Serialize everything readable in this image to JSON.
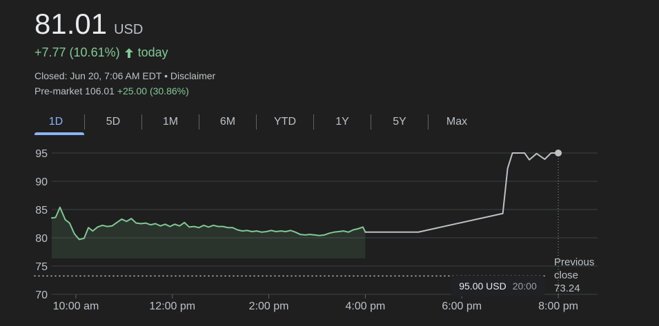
{
  "quote": {
    "price": "81.01",
    "currency": "USD",
    "change_text": "+7.77 (10.61%)",
    "today_label": "today",
    "closed_text": "Closed: Jun 20, 7:06 AM EDT • Disclaimer",
    "premarket_label": "Pre-market 106.01",
    "premarket_change": "+25.00 (30.86%)"
  },
  "tabs": [
    {
      "label": "1D",
      "selected": true
    },
    {
      "label": "5D",
      "selected": false
    },
    {
      "label": "1M",
      "selected": false
    },
    {
      "label": "6M",
      "selected": false
    },
    {
      "label": "YTD",
      "selected": false
    },
    {
      "label": "1Y",
      "selected": false
    },
    {
      "label": "5Y",
      "selected": false
    },
    {
      "label": "Max",
      "selected": false
    }
  ],
  "tooltip": {
    "price": "95.00 USD",
    "time": "20:00"
  },
  "previous_close": {
    "label_line_1": "Previous",
    "label_line_2": "close",
    "value": "73.24"
  },
  "colors": {
    "background": "#1f1f1f",
    "positive": "#81c995",
    "accent": "#8ab4f8",
    "grid": "#3c4043",
    "after_hours": "#bdc1c6"
  },
  "icons": {
    "change_arrow": "arrow-up-icon",
    "hover_marker": "dot-icon"
  },
  "chart_data": {
    "type": "line",
    "y_ticks": [
      "95",
      "90",
      "85",
      "80",
      "75",
      "70"
    ],
    "x_tick_labels": [
      "10:00 am",
      "12:00 pm",
      "2:00 pm",
      "4:00 pm",
      "6:00 pm",
      "8:00 pm"
    ],
    "ylim": [
      70,
      95
    ],
    "xlim": [
      9.5,
      20.5
    ],
    "grid": true,
    "previous_close": 73.24,
    "series": [
      {
        "segment": "regular",
        "color": "#81c995",
        "points": [
          [
            9.5,
            83.5
          ],
          [
            9.58,
            83.6
          ],
          [
            9.67,
            85.4
          ],
          [
            9.78,
            83.2
          ],
          [
            9.87,
            82.6
          ],
          [
            9.97,
            80.7
          ],
          [
            10.07,
            79.7
          ],
          [
            10.17,
            79.9
          ],
          [
            10.26,
            81.8
          ],
          [
            10.35,
            81.2
          ],
          [
            10.45,
            81.9
          ],
          [
            10.55,
            82.2
          ],
          [
            10.65,
            82.0
          ],
          [
            10.75,
            82.1
          ],
          [
            10.85,
            82.7
          ],
          [
            10.95,
            83.3
          ],
          [
            11.05,
            82.9
          ],
          [
            11.15,
            83.4
          ],
          [
            11.25,
            82.6
          ],
          [
            11.35,
            82.5
          ],
          [
            11.45,
            82.6
          ],
          [
            11.55,
            82.3
          ],
          [
            11.65,
            82.5
          ],
          [
            11.75,
            82.1
          ],
          [
            11.85,
            82.4
          ],
          [
            11.95,
            82.0
          ],
          [
            12.05,
            82.4
          ],
          [
            12.15,
            82.1
          ],
          [
            12.25,
            82.7
          ],
          [
            12.35,
            81.9
          ],
          [
            12.45,
            82.0
          ],
          [
            12.55,
            81.8
          ],
          [
            12.65,
            82.2
          ],
          [
            12.75,
            81.9
          ],
          [
            12.85,
            82.2
          ],
          [
            12.95,
            82.0
          ],
          [
            13.05,
            82.0
          ],
          [
            13.15,
            81.8
          ],
          [
            13.25,
            81.8
          ],
          [
            13.35,
            81.4
          ],
          [
            13.45,
            81.2
          ],
          [
            13.55,
            81.3
          ],
          [
            13.65,
            81.1
          ],
          [
            13.75,
            81.2
          ],
          [
            13.85,
            81.0
          ],
          [
            13.95,
            81.1
          ],
          [
            14.05,
            81.3
          ],
          [
            14.15,
            81.1
          ],
          [
            14.25,
            81.2
          ],
          [
            14.35,
            81.1
          ],
          [
            14.45,
            81.3
          ],
          [
            14.55,
            81.0
          ],
          [
            14.65,
            80.6
          ],
          [
            14.75,
            80.5
          ],
          [
            14.85,
            80.6
          ],
          [
            14.95,
            80.5
          ],
          [
            15.05,
            80.4
          ],
          [
            15.15,
            80.5
          ],
          [
            15.25,
            80.8
          ],
          [
            15.35,
            81.0
          ],
          [
            15.45,
            81.1
          ],
          [
            15.55,
            81.2
          ],
          [
            15.65,
            81.0
          ],
          [
            15.75,
            81.4
          ],
          [
            15.85,
            81.6
          ],
          [
            15.95,
            81.9
          ],
          [
            16.0,
            81.01
          ]
        ]
      },
      {
        "segment": "after_hours",
        "color": "#bdc1c6",
        "points": [
          [
            16.0,
            81.01
          ],
          [
            17.1,
            81.01
          ],
          [
            18.85,
            84.3
          ],
          [
            18.95,
            92.3
          ],
          [
            19.05,
            95.0
          ],
          [
            19.3,
            95.0
          ],
          [
            19.4,
            93.8
          ],
          [
            19.55,
            94.9
          ],
          [
            19.72,
            93.9
          ],
          [
            19.85,
            95.0
          ],
          [
            20.0,
            95.0
          ]
        ]
      }
    ]
  }
}
